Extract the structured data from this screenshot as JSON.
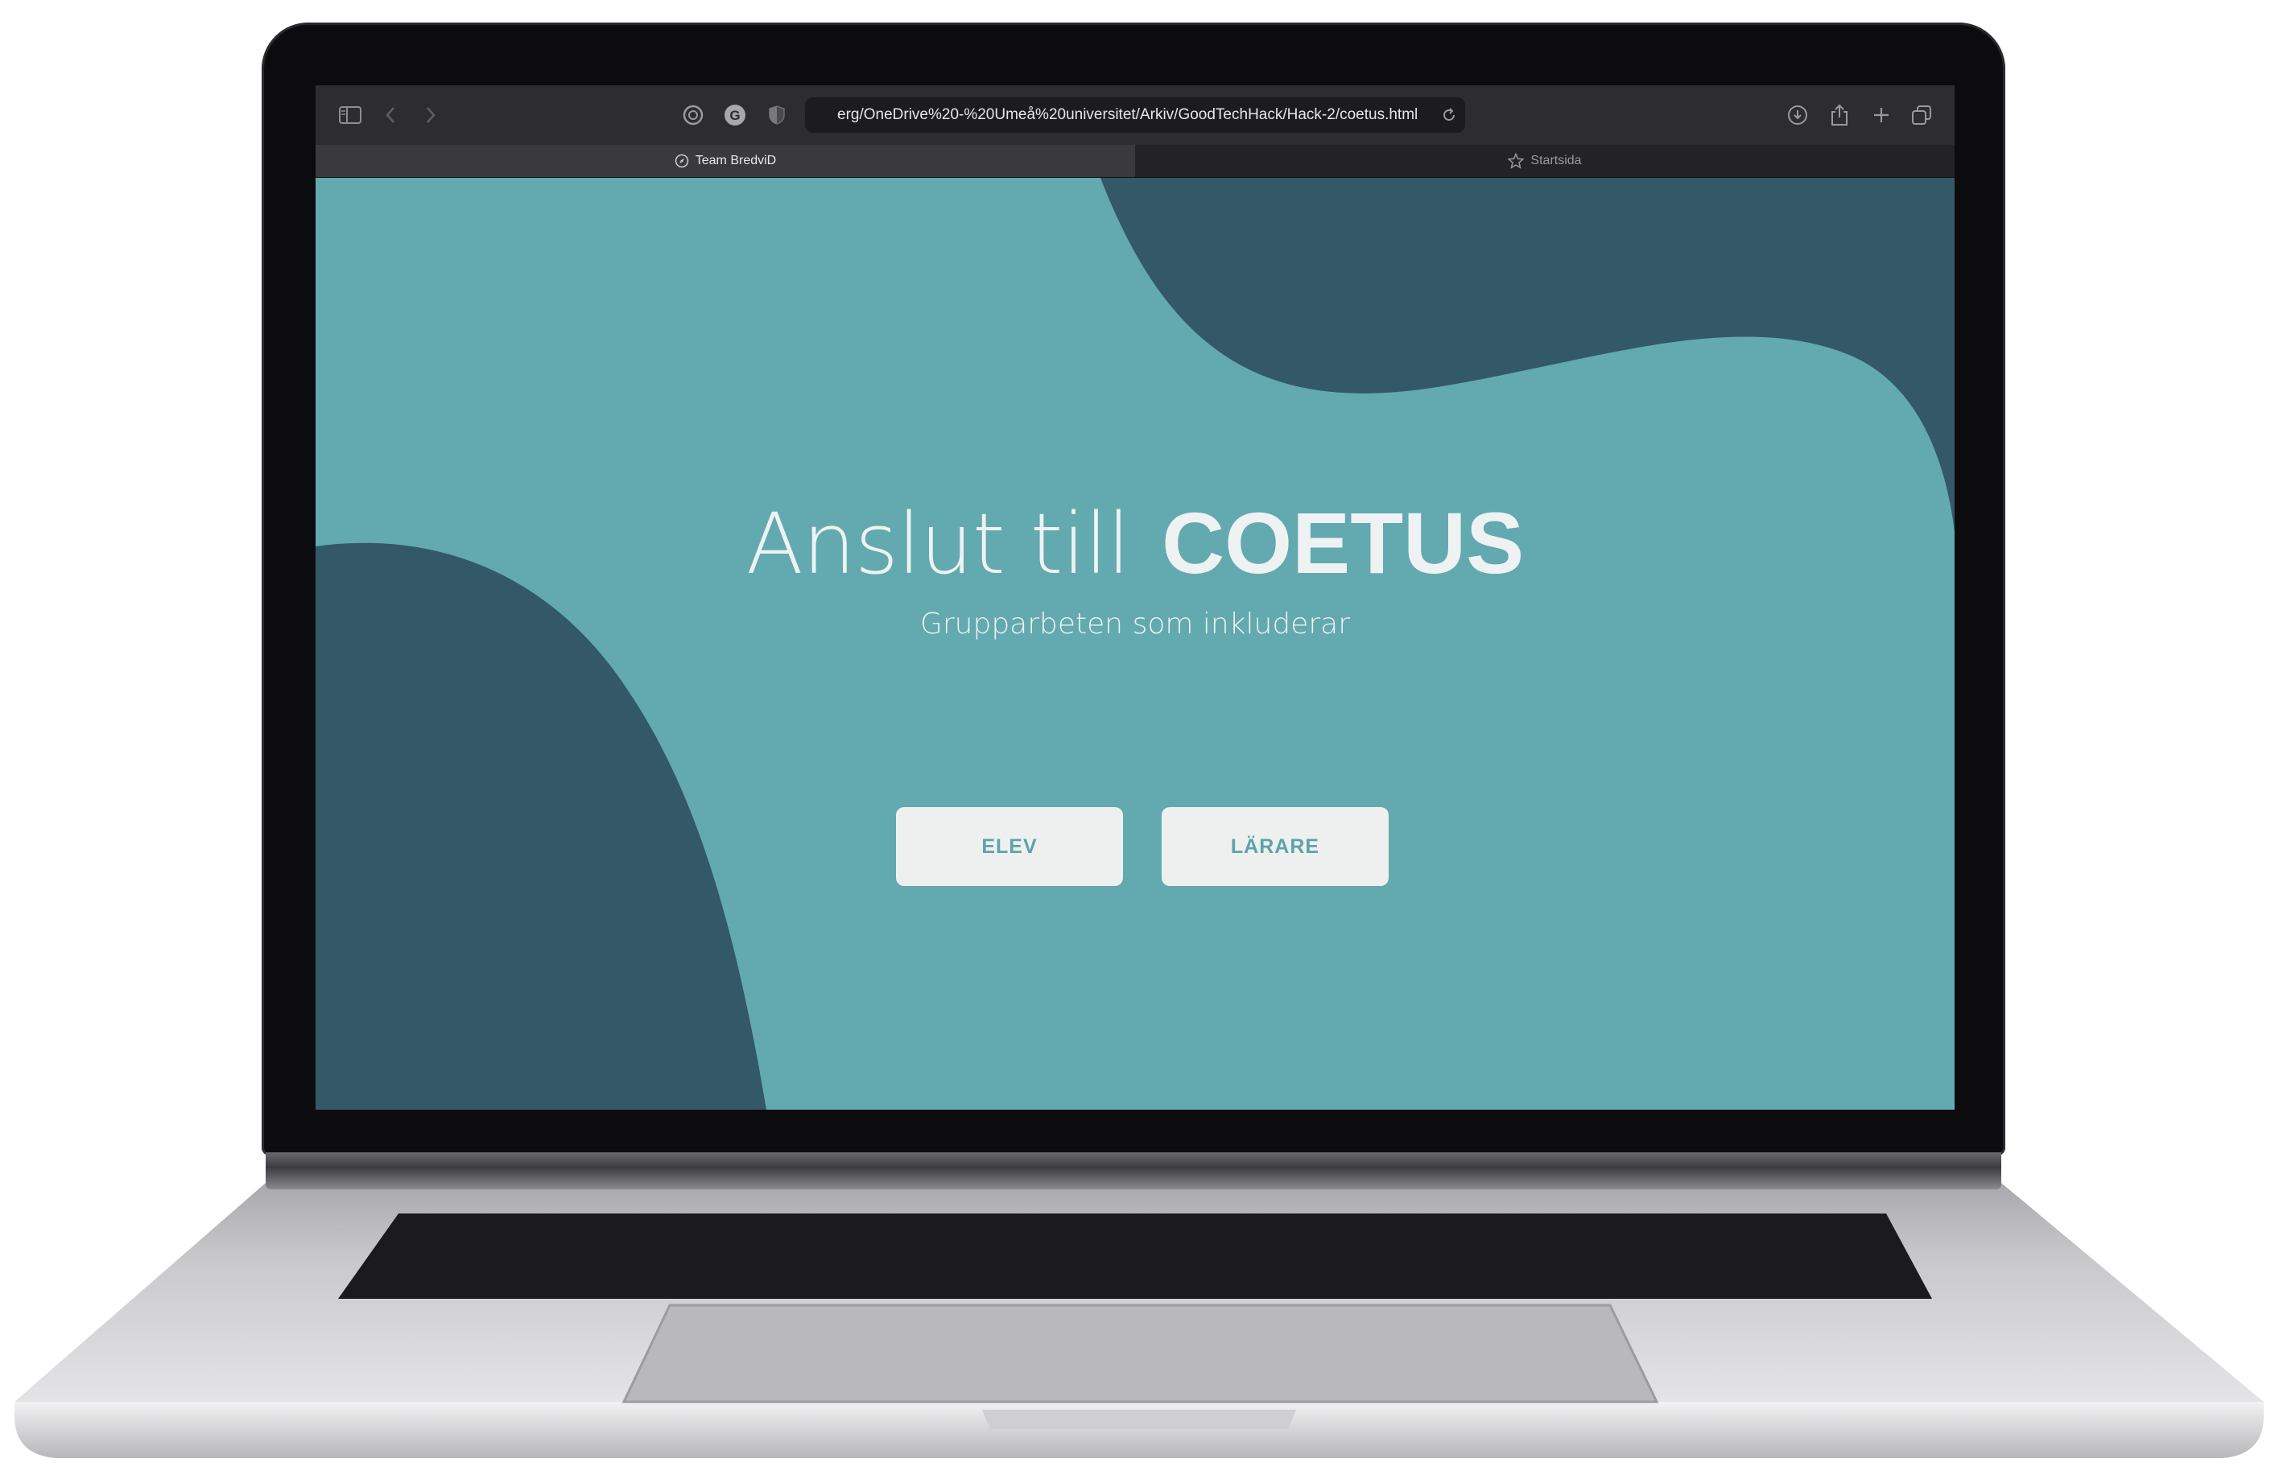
{
  "browser": {
    "url": "erg/OneDrive%20-%20Umeå%20universitet/Arkiv/GoodTechHack/Hack-2/coetus.html",
    "tabs": [
      {
        "label": "Team BredviD",
        "icon": "compass-icon",
        "active": true
      },
      {
        "label": "Startsida",
        "icon": "star-icon",
        "active": false
      }
    ],
    "toolbar_icons": [
      "sidebar-icon",
      "back-icon",
      "forward-icon",
      "extension-icon",
      "grammarly-icon",
      "privacy-shield-icon",
      "reload-icon",
      "download-icon",
      "share-icon",
      "new-tab-icon",
      "tab-overview-icon"
    ]
  },
  "page": {
    "title_lead": "Anslut till",
    "title_brand": "COETUS",
    "subtitle": "Grupparbeten som inkluderar",
    "buttons": {
      "student": "ELEV",
      "teacher": "LÄRARE"
    }
  },
  "colors": {
    "page_background": "#63a9b0",
    "blob": "#335867",
    "text": "#eef2f2",
    "button_background": "#eef0f0",
    "button_text": "#5ea3a9"
  }
}
